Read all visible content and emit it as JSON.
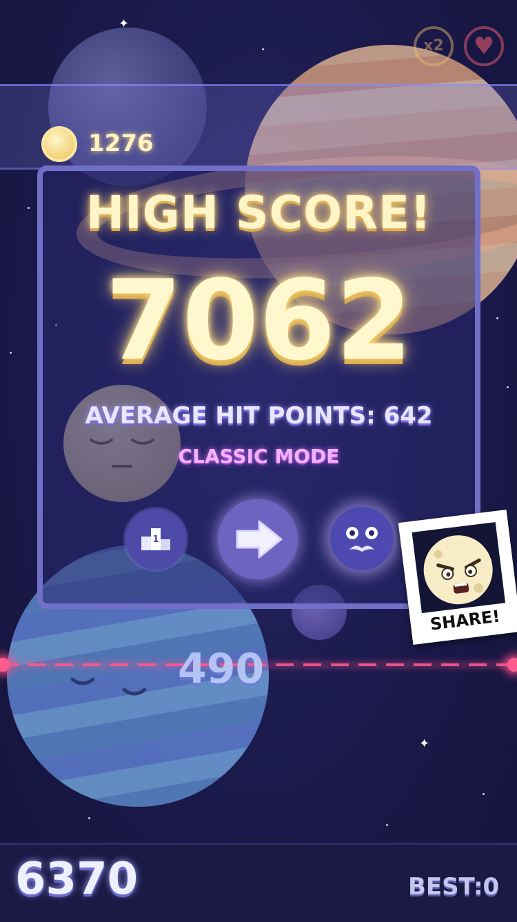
{
  "hud": {
    "coins": "1276",
    "multiplier_label": "x2",
    "coin_icon": "coin-icon",
    "heart_icon": "heart-icon"
  },
  "result": {
    "title": "HIGH SCORE!",
    "score": "7062",
    "average_label": "AVERAGE HIT POINTS: 642",
    "mode": "CLASSIC MODE",
    "leaderboard_rank": "1"
  },
  "share": {
    "label": "SHARE!"
  },
  "field": {
    "hit_points": "490"
  },
  "bottom": {
    "current_score": "6370",
    "best": "BEST:0"
  },
  "colors": {
    "background": "#1c1b4e",
    "panel_border": "#7170c8",
    "score_text": "#fff8cf",
    "mode_text": "#f3b2ff",
    "laser": "#ff5c8e"
  }
}
